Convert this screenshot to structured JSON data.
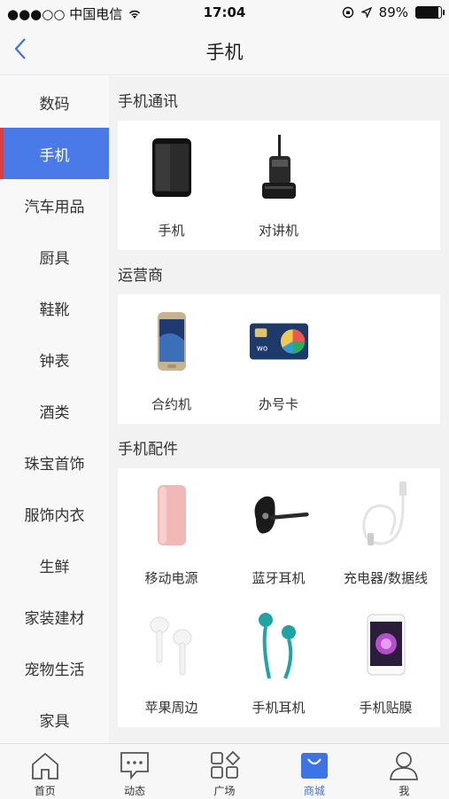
{
  "status": {
    "carrier": "●●●○○ 中国电信",
    "time": "17:04",
    "battery": "89%",
    "battery_level": 0.89
  },
  "nav": {
    "back_icon": "chevron-left-icon",
    "title": "手机"
  },
  "sidebar": {
    "items": [
      {
        "label": "数码"
      },
      {
        "label": "手机"
      },
      {
        "label": "汽车用品"
      },
      {
        "label": "厨具"
      },
      {
        "label": "鞋靴"
      },
      {
        "label": "钟表"
      },
      {
        "label": "酒类"
      },
      {
        "label": "珠宝首饰"
      },
      {
        "label": "服饰内衣"
      },
      {
        "label": "生鲜"
      },
      {
        "label": "家装建材"
      },
      {
        "label": "宠物生活"
      },
      {
        "label": "家具"
      }
    ],
    "active_index": 1,
    "active_color": "#4a7ae8",
    "marker_color": "#e23c3c"
  },
  "sections": [
    {
      "title": "手机通讯",
      "items": [
        {
          "label": "手机",
          "icon": "smartphone-icon"
        },
        {
          "label": "对讲机",
          "icon": "walkie-talkie-icon"
        }
      ]
    },
    {
      "title": "运营商",
      "items": [
        {
          "label": "合约机",
          "icon": "contract-phone-icon"
        },
        {
          "label": "办号卡",
          "icon": "sim-card-icon"
        }
      ]
    },
    {
      "title": "手机配件",
      "items": [
        {
          "label": "移动电源",
          "icon": "power-bank-icon"
        },
        {
          "label": "蓝牙耳机",
          "icon": "bluetooth-headset-icon"
        },
        {
          "label": "充电器/数据线",
          "icon": "cable-icon"
        },
        {
          "label": "苹果周边",
          "icon": "earpods-icon"
        },
        {
          "label": "手机耳机",
          "icon": "earphones-icon"
        },
        {
          "label": "手机贴膜",
          "icon": "screen-protector-icon"
        }
      ]
    }
  ],
  "tabbar": {
    "items": [
      {
        "label": "首页",
        "icon": "home-icon"
      },
      {
        "label": "动态",
        "icon": "chat-icon"
      },
      {
        "label": "广场",
        "icon": "grid-icon"
      },
      {
        "label": "商城",
        "icon": "shopping-bag-icon"
      },
      {
        "label": "我",
        "icon": "user-icon"
      }
    ],
    "active_index": 3,
    "active_color": "#3c73e6"
  }
}
